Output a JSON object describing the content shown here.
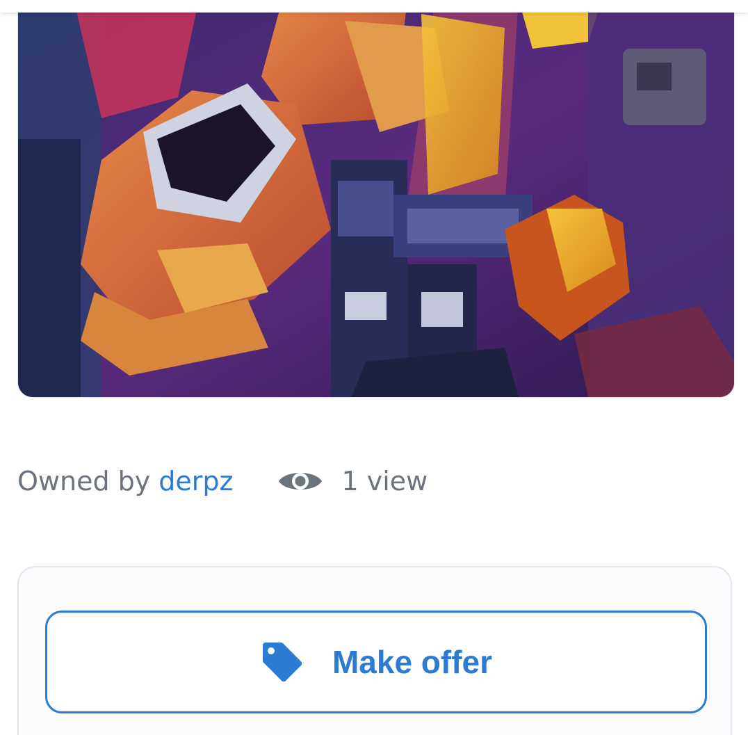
{
  "artwork": {
    "icon": "nft-artwork-image"
  },
  "ownership": {
    "owned_by_label": "Owned by",
    "owner_name": "derpz"
  },
  "views": {
    "icon": "eye-icon",
    "label": "1 view"
  },
  "offer": {
    "icon": "tag-icon",
    "button_label": "Make offer"
  },
  "colors": {
    "accent": "#2b7bd3",
    "muted_text": "#6b737c",
    "border": "#e3e6ea"
  }
}
